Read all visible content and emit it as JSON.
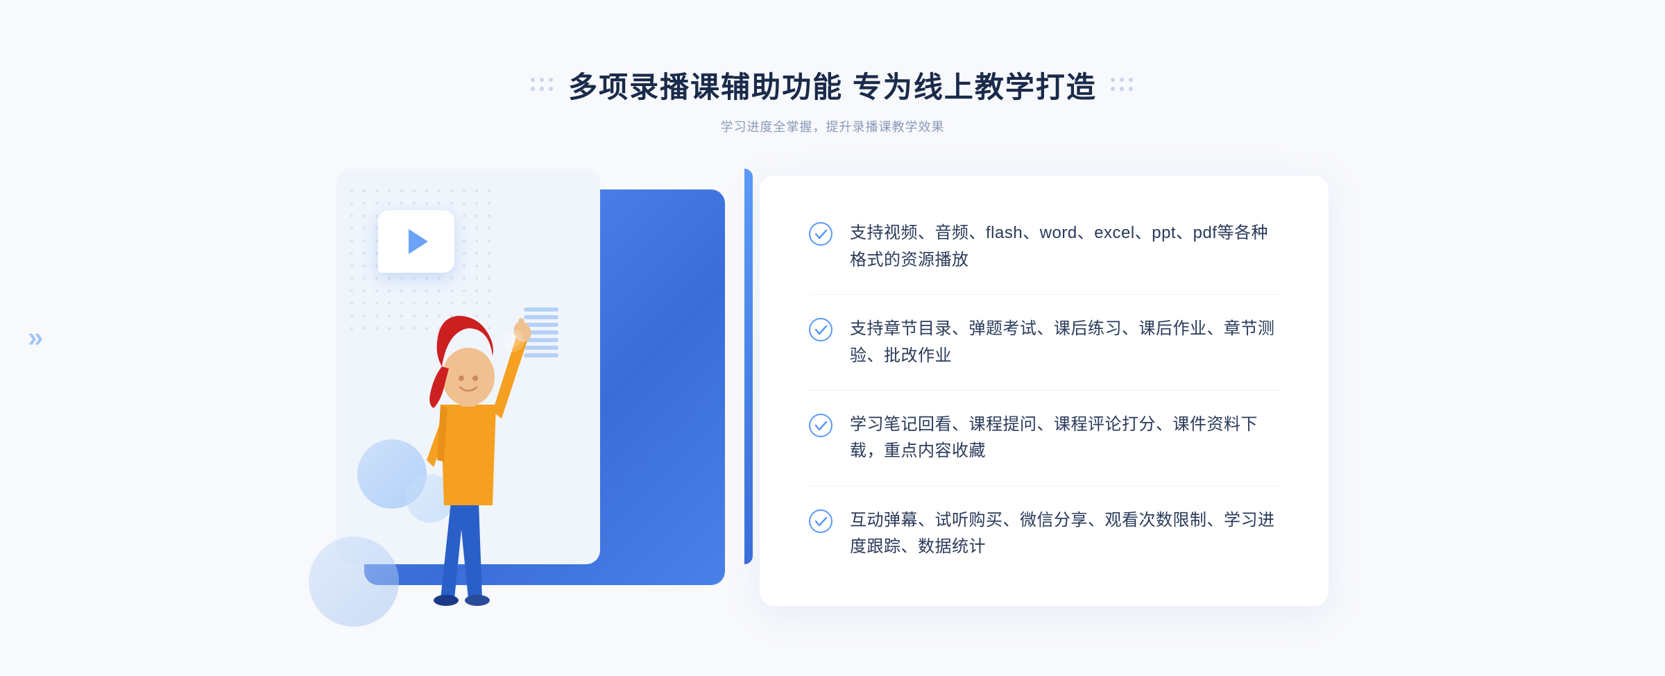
{
  "page": {
    "background": "#f8f9fc"
  },
  "header": {
    "main_title": "多项录播课辅助功能 专为线上教学打造",
    "sub_title": "学习进度全掌握，提升录播课教学效果"
  },
  "features": [
    {
      "id": 1,
      "text": "支持视频、音频、flash、word、excel、ppt、pdf等各种格式的资源播放"
    },
    {
      "id": 2,
      "text": "支持章节目录、弹题考试、课后练习、课后作业、章节测验、批改作业"
    },
    {
      "id": 3,
      "text": "学习笔记回看、课程提问、课程评论打分、课件资料下载，重点内容收藏"
    },
    {
      "id": 4,
      "text": "互动弹幕、试听购买、微信分享、观看次数限制、学习进度跟踪、数据统计"
    }
  ],
  "illustration": {
    "play_label": "▶"
  },
  "icons": {
    "check_circle": "check-circle",
    "chevron_left": "«"
  }
}
